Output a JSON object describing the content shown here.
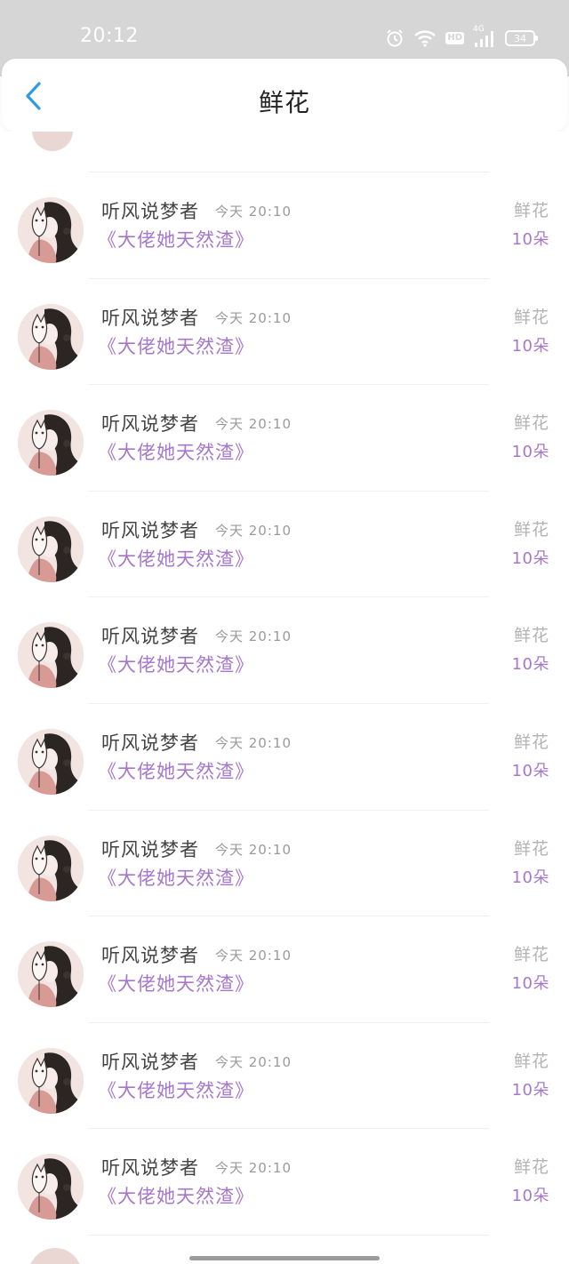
{
  "status_bar": {
    "time": "20:12",
    "hd": "HD",
    "network": "4G",
    "battery": "34"
  },
  "header": {
    "title": "鲜花"
  },
  "gifts": [
    {
      "user": "听风说梦者",
      "time": "今天 20:10",
      "book": "《大佬她天然渣》",
      "type": "鲜花",
      "amount": "10朵"
    },
    {
      "user": "听风说梦者",
      "time": "今天 20:10",
      "book": "《大佬她天然渣》",
      "type": "鲜花",
      "amount": "10朵"
    },
    {
      "user": "听风说梦者",
      "time": "今天 20:10",
      "book": "《大佬她天然渣》",
      "type": "鲜花",
      "amount": "10朵"
    },
    {
      "user": "听风说梦者",
      "time": "今天 20:10",
      "book": "《大佬她天然渣》",
      "type": "鲜花",
      "amount": "10朵"
    },
    {
      "user": "听风说梦者",
      "time": "今天 20:10",
      "book": "《大佬她天然渣》",
      "type": "鲜花",
      "amount": "10朵"
    },
    {
      "user": "听风说梦者",
      "time": "今天 20:10",
      "book": "《大佬她天然渣》",
      "type": "鲜花",
      "amount": "10朵"
    },
    {
      "user": "听风说梦者",
      "time": "今天 20:10",
      "book": "《大佬她天然渣》",
      "type": "鲜花",
      "amount": "10朵"
    },
    {
      "user": "听风说梦者",
      "time": "今天 20:10",
      "book": "《大佬她天然渣》",
      "type": "鲜花",
      "amount": "10朵"
    },
    {
      "user": "听风说梦者",
      "time": "今天 20:10",
      "book": "《大佬她天然渣》",
      "type": "鲜花",
      "amount": "10朵"
    },
    {
      "user": "听风说梦者",
      "time": "今天 20:10",
      "book": "《大佬她天然渣》",
      "type": "鲜花",
      "amount": "10朵"
    }
  ],
  "colors": {
    "accent": "#a678cc",
    "back_arrow": "#2f9be8",
    "status_bar_bg": "#d6d6d6"
  }
}
